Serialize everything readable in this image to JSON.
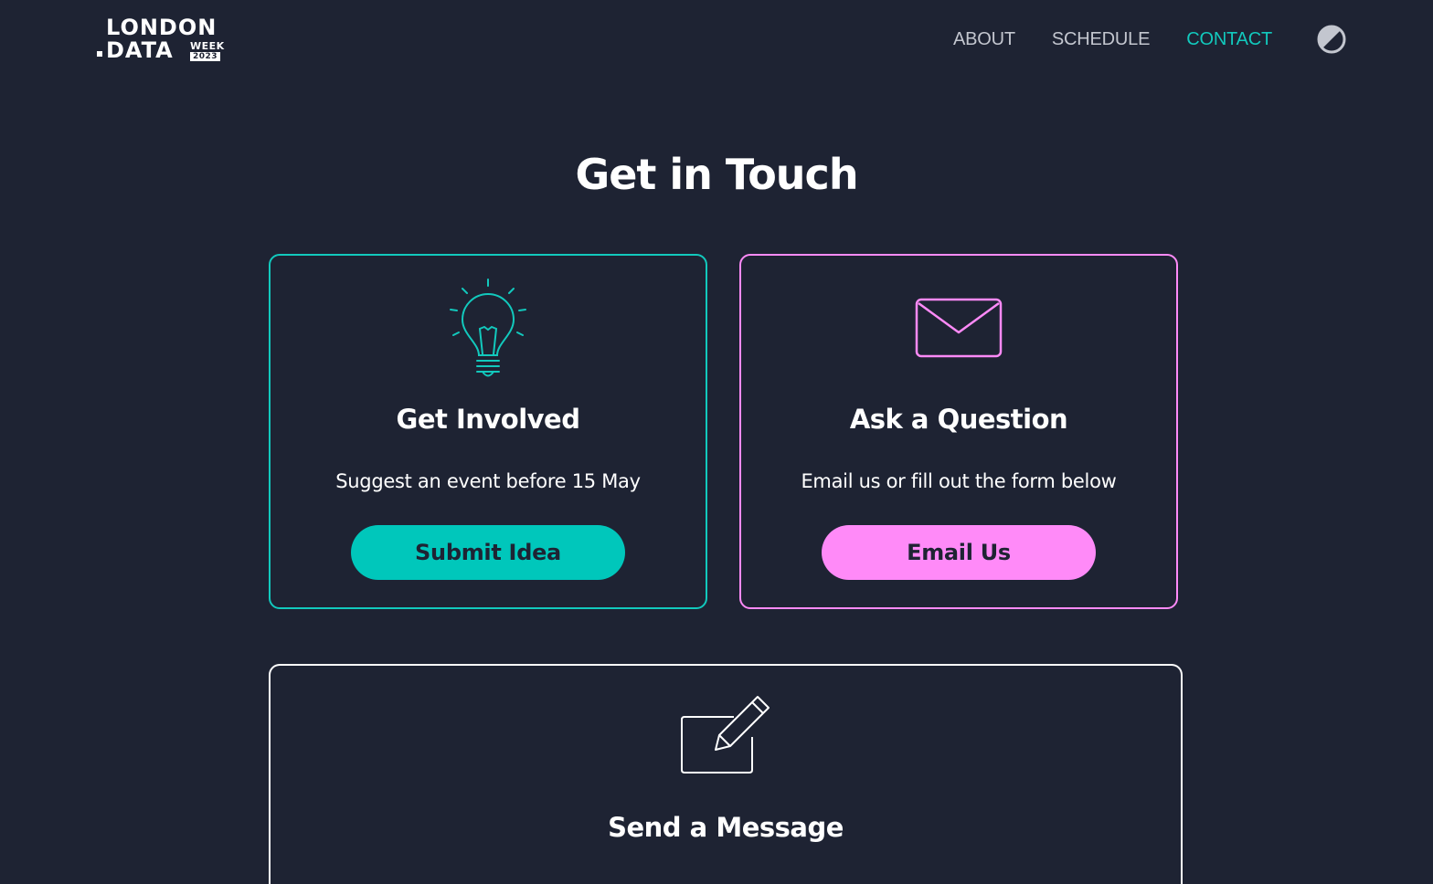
{
  "logo": {
    "line1": "LONDON",
    "line2": "DATA",
    "week": "WEEK",
    "year": "2023"
  },
  "nav": {
    "items": [
      {
        "label": "ABOUT",
        "active": false
      },
      {
        "label": "SCHEDULE",
        "active": false
      },
      {
        "label": "CONTACT",
        "active": true
      }
    ],
    "theme_toggle_icon": "contrast-icon"
  },
  "page_title": "Get in Touch",
  "cards": {
    "involved": {
      "icon": "lightbulb-icon",
      "title": "Get Involved",
      "text": "Suggest an event before 15 May",
      "button": "Submit Idea"
    },
    "question": {
      "icon": "envelope-icon",
      "title": "Ask a Question",
      "text": "Email us or fill out the form below",
      "button": "Email Us"
    },
    "message": {
      "icon": "edit-icon",
      "title": "Send a Message"
    }
  },
  "colors": {
    "background": "#1e2333",
    "accent_teal": "#12c9bd",
    "accent_pink": "#ff8af8",
    "text": "#ffffff"
  }
}
